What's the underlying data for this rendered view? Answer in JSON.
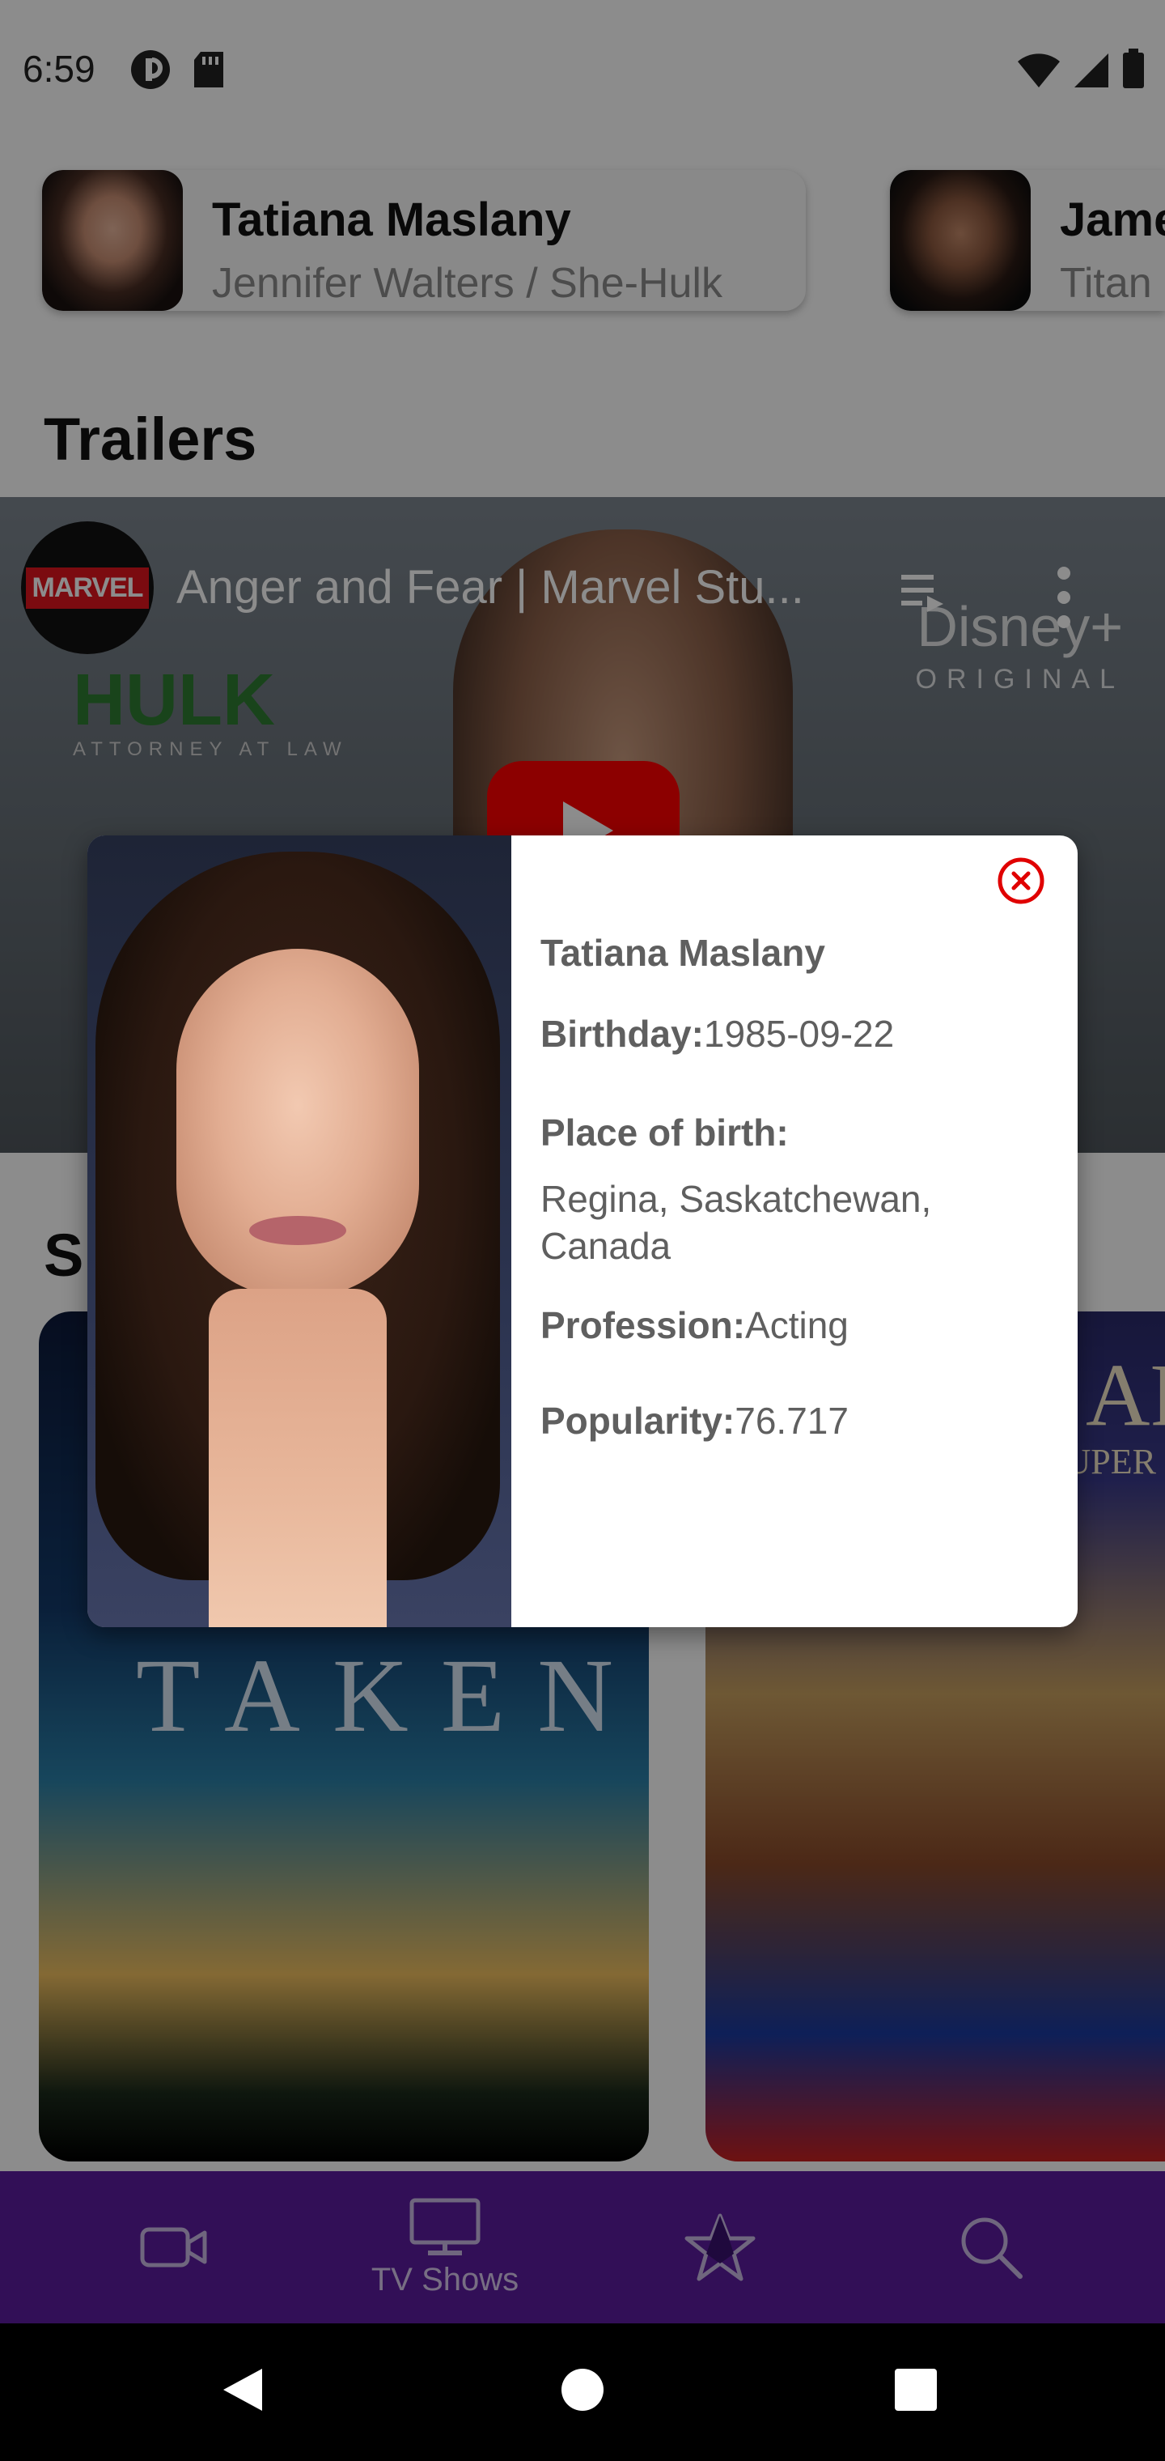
{
  "status_bar": {
    "time": "6:59"
  },
  "cast": [
    {
      "name": "Tatiana Maslany",
      "role": "Jennifer Walters / She-Hulk"
    },
    {
      "name": "Jame",
      "role": "Titan"
    }
  ],
  "trailers": {
    "title": "Trailers",
    "video_title": "Anger and Fear | Marvel Stu...",
    "channel_label": "MARVEL",
    "brand": "Disney+",
    "brand_sub": "ORIGINAL",
    "overlay_title": "HULK",
    "overlay_sub": "ATTORNEY AT LAW"
  },
  "similar": {
    "title_fragment": "S",
    "poster_left_title": "TAKEN",
    "poster_right_title": "ARI",
    "poster_right_sub": "SUPER"
  },
  "bottom_nav": {
    "items": [
      {
        "icon": "video-camera-icon",
        "label": ""
      },
      {
        "icon": "tv-icon",
        "label": "TV Shows"
      },
      {
        "icon": "star-icon",
        "label": ""
      },
      {
        "icon": "search-icon",
        "label": ""
      }
    ]
  },
  "dialog": {
    "name": "Tatiana Maslany",
    "birthday_label": "Birthday:",
    "birthday": "1985-09-22",
    "place_label": "Place of birth:",
    "place": "Regina, Saskatchewan, Canada",
    "profession_label": "Profession:",
    "profession": "Acting",
    "popularity_label": "Popularity:",
    "popularity": "76.717"
  },
  "colors": {
    "nav_background": "#5b1c9e",
    "close_icon": "#e00000",
    "youtube_red": "#ff0000",
    "dialog_text": "#5f5f5f"
  }
}
